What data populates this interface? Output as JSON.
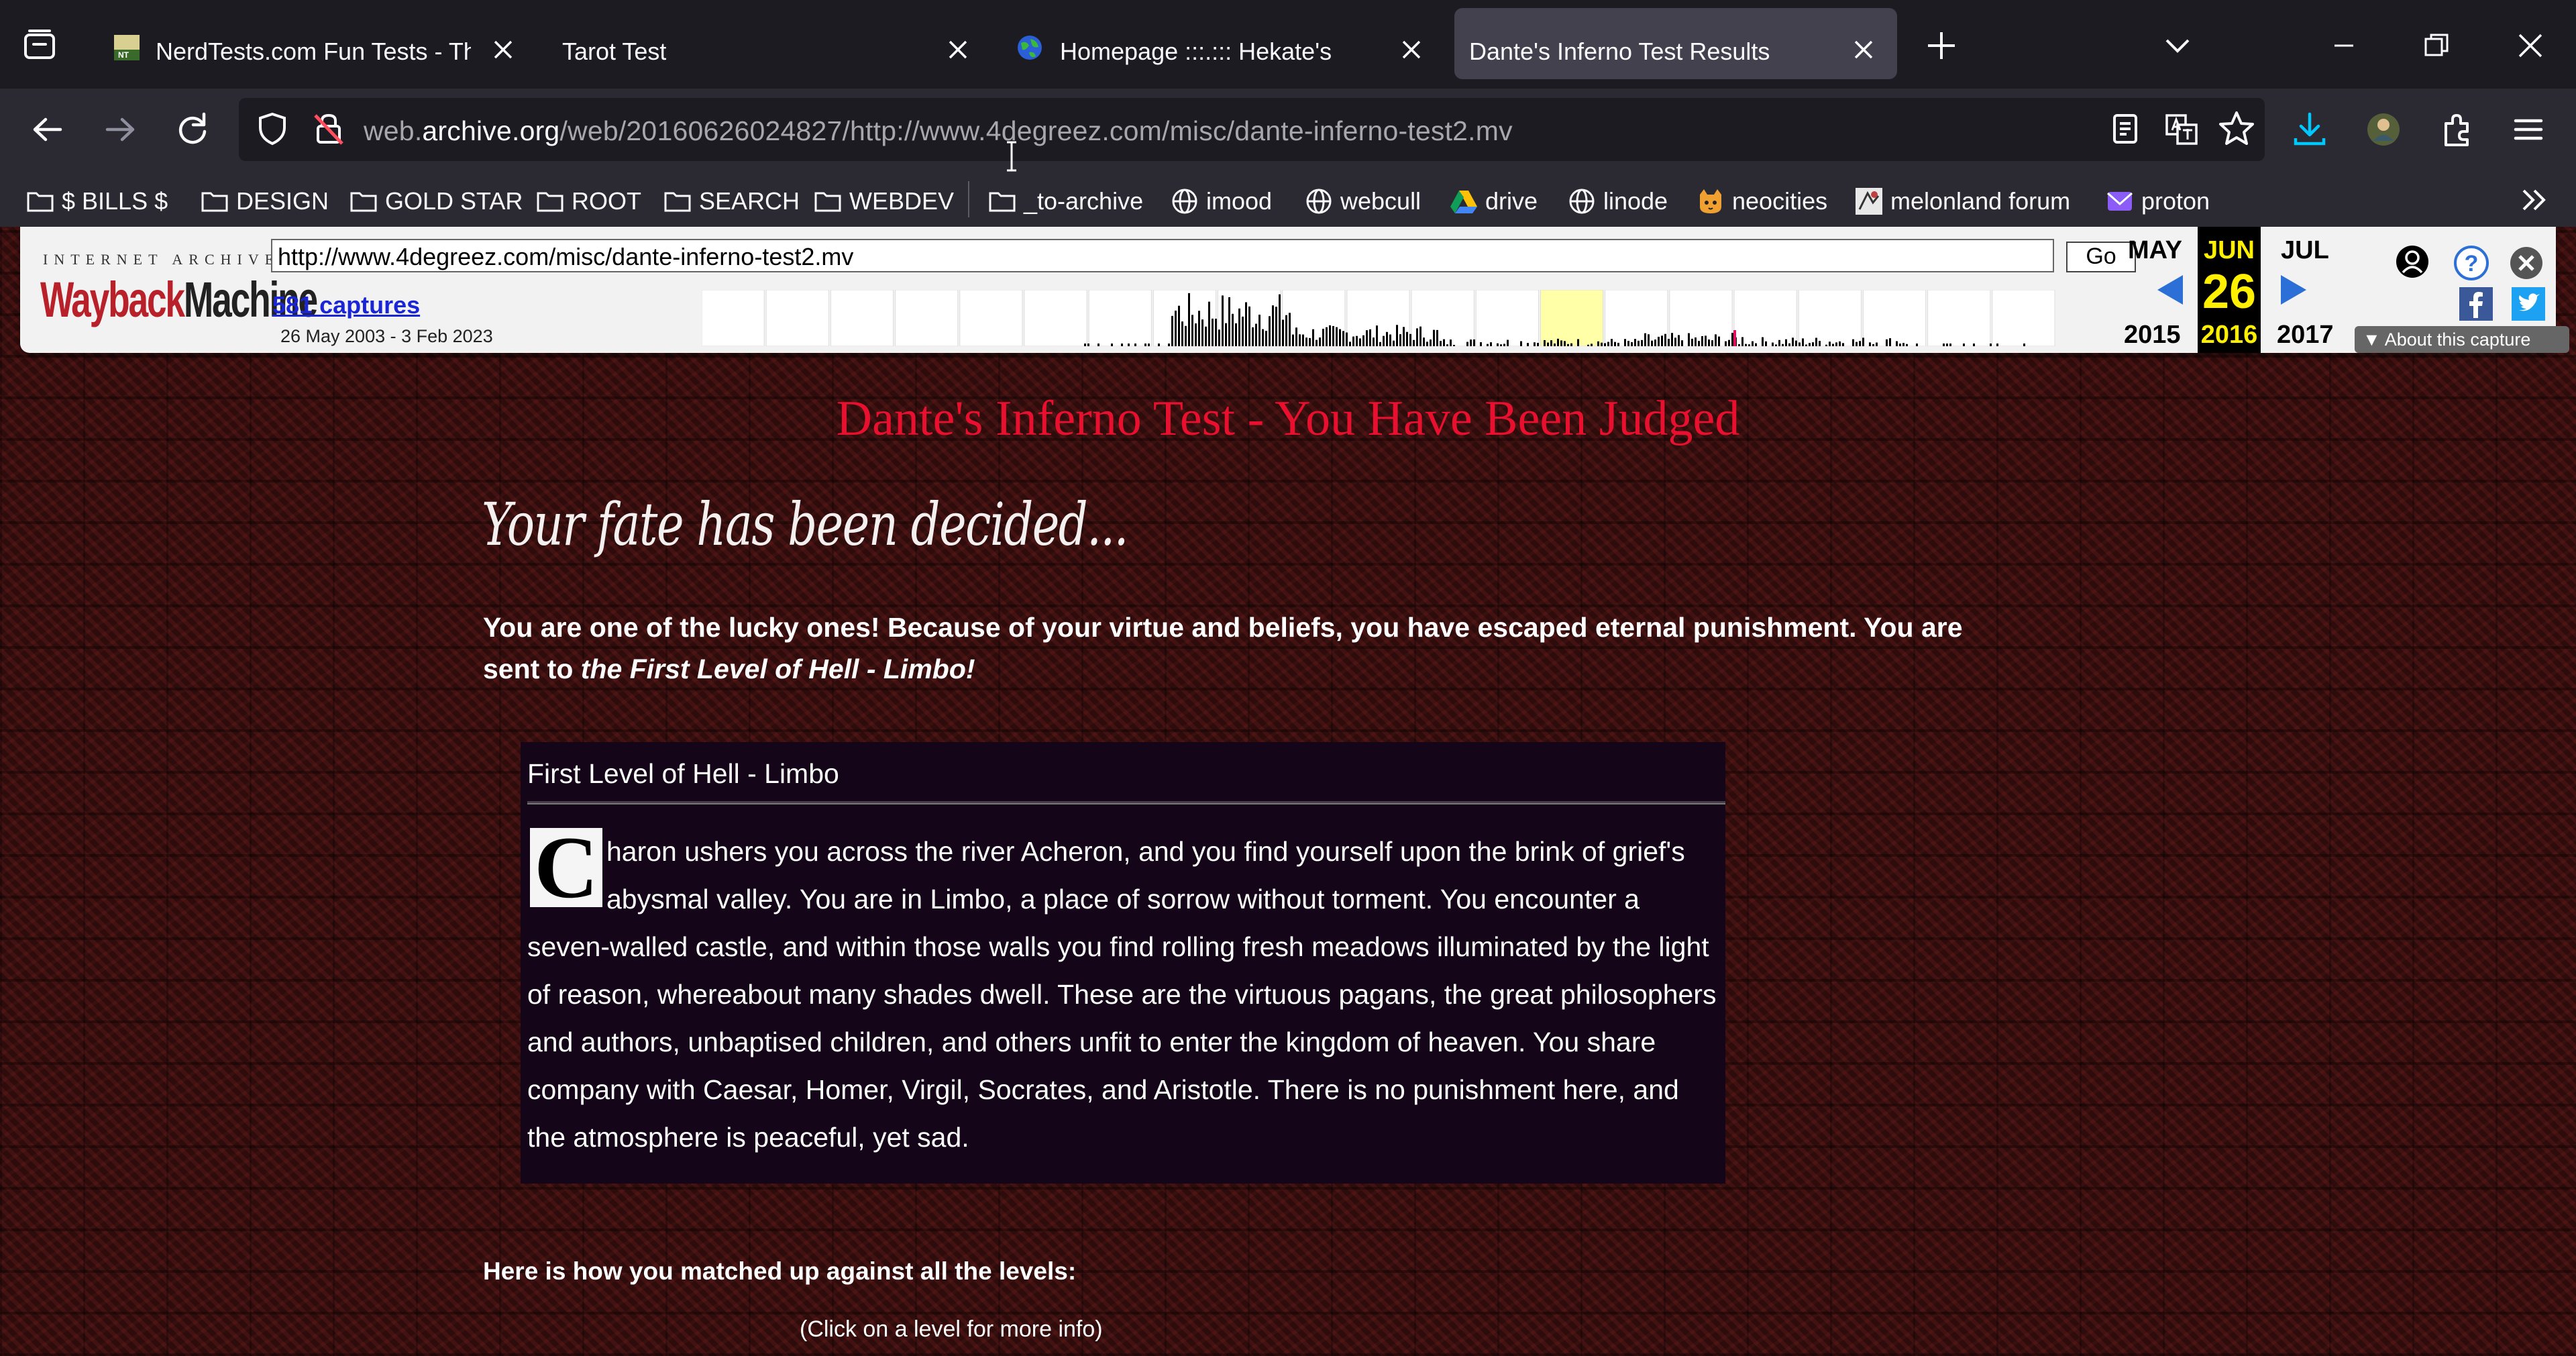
{
  "browser": {
    "tabs": [
      {
        "title": "NerdTests.com Fun Tests - The N",
        "favicon": "nerdtests-favicon",
        "active": false
      },
      {
        "title": "Tarot Test",
        "favicon": "none",
        "active": false
      },
      {
        "title": "Homepage :::.::: Hekate's",
        "favicon": "globe-favicon",
        "active": false
      },
      {
        "title": "Dante's Inferno Test Results",
        "favicon": "none",
        "active": true
      }
    ],
    "url": {
      "prefix": "web.",
      "domain": "archive.org",
      "path": "/web/20160626024827/http://www.4degreez.com/misc/dante-inferno-test2.mv"
    },
    "bookmarks": [
      {
        "label": "$ BILLS $",
        "icon": "folder-icon"
      },
      {
        "label": "DESIGN",
        "icon": "folder-icon"
      },
      {
        "label": "GOLD STAR",
        "icon": "folder-icon"
      },
      {
        "label": "ROOT",
        "icon": "folder-icon"
      },
      {
        "label": "SEARCH",
        "icon": "folder-icon"
      },
      {
        "label": "WEBDEV",
        "icon": "folder-icon"
      },
      {
        "label": "_to-archive",
        "icon": "folder-icon"
      },
      {
        "label": "imood",
        "icon": "globe-icon"
      },
      {
        "label": "webcull",
        "icon": "globe-icon"
      },
      {
        "label": "drive",
        "icon": "drive-icon"
      },
      {
        "label": "linode",
        "icon": "globe-icon"
      },
      {
        "label": "neocities",
        "icon": "cat-icon"
      },
      {
        "label": "melonland forum",
        "icon": "melonland-icon"
      },
      {
        "label": "proton",
        "icon": "proton-mail-icon"
      }
    ]
  },
  "wayback": {
    "logo_top": "INTERNET ARCHIVE",
    "logo_word_a": "Wayback",
    "logo_word_b": "Machine",
    "url_input": "http://www.4degreez.com/misc/dante-inferno-test2.mv",
    "go_label": "Go",
    "captures": "581 captures",
    "range": "26 May 2003 - 3 Feb 2023",
    "prev_month": "MAY",
    "cur_month": "JUN",
    "next_month": "JUL",
    "prev_year": "2015",
    "cur_day": "26",
    "cur_year": "2016",
    "next_year": "2017",
    "about": "About this capture"
  },
  "page": {
    "heading": "Dante's Inferno Test - You Have Been Judged",
    "fate": "Your fate has been decided...",
    "verdict_main": "You are one of the lucky ones! Because of your virtue and beliefs, you have escaped eternal punishment. You are sent to ",
    "verdict_level": "the First Level of Hell - Limbo!",
    "level_title": "First Level of Hell - Limbo",
    "dropcap": "C",
    "level_text": "haron ushers you across the river Acheron, and you find yourself upon the brink of grief's abysmal valley. You are in Limbo, a place of sorrow without torment. You encounter a seven-walled castle, and within those walls you find rolling fresh meadows illuminated by the light of reason, whereabout many shades dwell. These are the virtuous pagans, the great philosophers and authors, unbaptised children, and others unfit to enter the kingdom of heaven. You share company with Caesar, Homer, Virgil, Socrates, and Aristotle. There is no punishment here, and the atmosphere is peaceful, yet sad.",
    "matched_heading": "Here is how you matched up against all the levels:",
    "click_info": "(Click on a level for more info)"
  },
  "colors": {
    "heading": "#e8102e",
    "wayback_day": "#ffef00",
    "captures_link": "#1a25d6",
    "page_bg": "#3a1212"
  }
}
